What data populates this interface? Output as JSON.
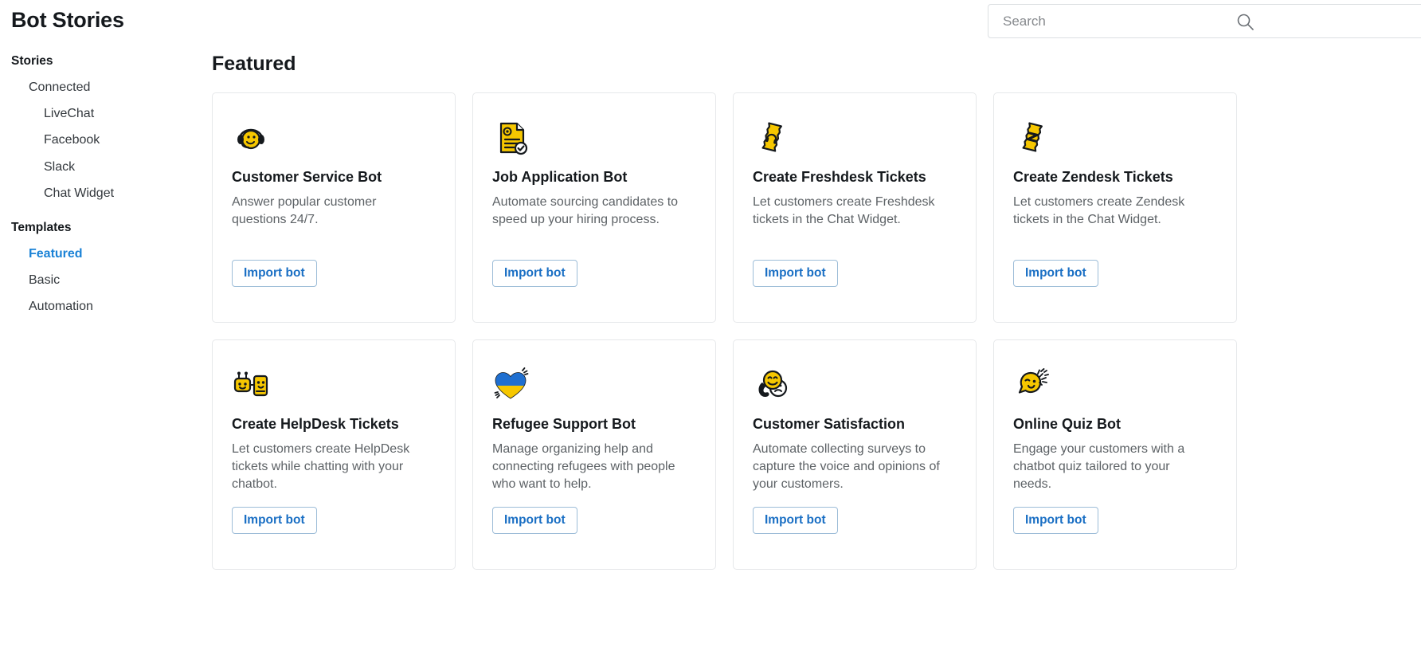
{
  "header": {
    "title": "Bot Stories"
  },
  "search": {
    "placeholder": "Search",
    "value": "",
    "icon": "search-icon"
  },
  "sidebar": {
    "groups": [
      {
        "title": "Stories",
        "items": [
          {
            "label": "Connected",
            "level": 1,
            "active": false
          },
          {
            "label": "LiveChat",
            "level": 2,
            "active": false
          },
          {
            "label": "Facebook",
            "level": 2,
            "active": false
          },
          {
            "label": "Slack",
            "level": 2,
            "active": false
          },
          {
            "label": "Chat Widget",
            "level": 2,
            "active": false
          }
        ]
      },
      {
        "title": "Templates",
        "items": [
          {
            "label": "Featured",
            "level": 1,
            "active": true
          },
          {
            "label": "Basic",
            "level": 1,
            "active": false
          },
          {
            "label": "Automation",
            "level": 1,
            "active": false
          }
        ]
      }
    ],
    "labels": {
      "stories": "Stories",
      "connected": "Connected",
      "livechat": "LiveChat",
      "facebook": "Facebook",
      "slack": "Slack",
      "chat_widget": "Chat Widget",
      "templates": "Templates",
      "featured": "Featured",
      "basic": "Basic",
      "automation": "Automation"
    }
  },
  "main": {
    "section_title": "Featured",
    "import_label": "Import bot",
    "cards": [
      {
        "title": "Customer Service Bot",
        "description": "Answer popular customer questions 24/7.",
        "icon": "headset-smiley-icon",
        "button": "Import bot"
      },
      {
        "title": "Job Application Bot",
        "description": "Automate sourcing candidates to speed up your hiring process.",
        "icon": "document-check-icon",
        "button": "Import bot"
      },
      {
        "title": "Create Freshdesk Tickets",
        "description": "Let customers create Freshdesk tickets in the Chat Widget.",
        "icon": "ticket-headphones-icon",
        "button": "Import bot"
      },
      {
        "title": "Create Zendesk Tickets",
        "description": "Let customers create Zendesk tickets in the Chat Widget.",
        "icon": "ticket-zendesk-icon",
        "button": "Import bot"
      },
      {
        "title": "Create HelpDesk Tickets",
        "description": "Let customers create HelpDesk tickets while chatting with your chatbot.",
        "icon": "robot-chat-icon",
        "button": "Import bot"
      },
      {
        "title": "Refugee Support Bot",
        "description": "Manage organizing help and connecting refugees with people who want to help.",
        "icon": "ukraine-heart-icon",
        "button": "Import bot"
      },
      {
        "title": "Customer Satisfaction",
        "description": "Automate collecting surveys to capture the voice and opinions of your customers.",
        "icon": "happy-sad-faces-icon",
        "button": "Import bot"
      },
      {
        "title": "Online Quiz Bot",
        "description": "Engage your customers with a chatbot quiz tailored to your needs.",
        "icon": "winking-face-sparkles-icon",
        "button": "Import bot"
      }
    ]
  },
  "colors": {
    "accent_blue": "#1a82d6",
    "link_blue": "#1a6fc4",
    "icon_yellow": "#f6c700",
    "text_dark": "#15191d",
    "text_muted": "#5d6266",
    "border": "#e6e8ea"
  }
}
